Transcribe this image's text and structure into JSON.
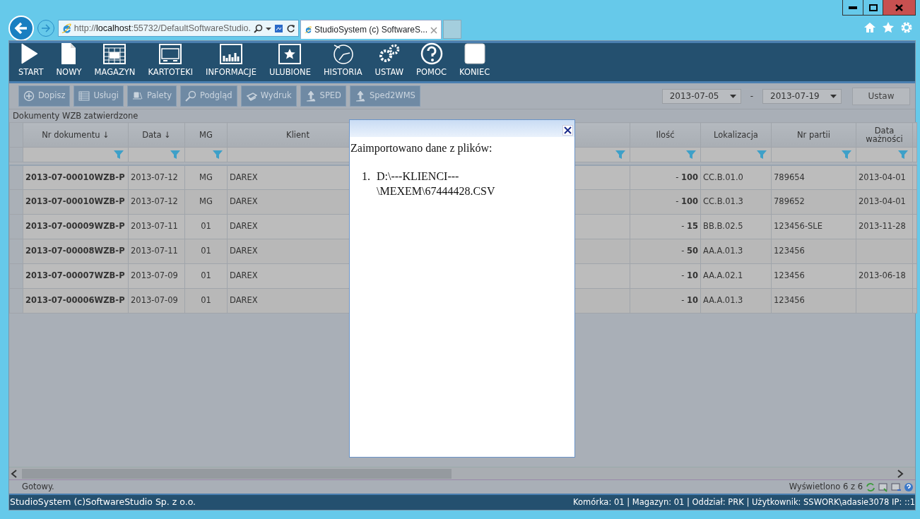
{
  "browser": {
    "address": {
      "scheme": "http://",
      "host": "localhost",
      "rest": ":55732/DefaultSoftwareStudio."
    },
    "tab_title": "StudioSystem (c) SoftwareS..."
  },
  "nav": [
    "START",
    "NOWY",
    "MAGAZYN",
    "KARTOTEKI",
    "INFORMACJE",
    "ULUBIONE",
    "HISTORIA",
    "USTAW",
    "POMOC",
    "KONIEC"
  ],
  "toolbar": [
    "Dopisz",
    "Usługi",
    "Palety",
    "Podgląd",
    "Wydruk",
    "SPED",
    "Sped2WMS"
  ],
  "date_range": {
    "from": "2013-07-05",
    "separator": "-",
    "to": "2013-07-19",
    "apply": "Ustaw"
  },
  "caption": "Dokumenty WZB zatwierdzone",
  "table": {
    "columns": [
      {
        "label": "Nr dokumentu ↓",
        "filter": true
      },
      {
        "label": "Data ↓",
        "filter": true
      },
      {
        "label": "MG",
        "filter": true
      },
      {
        "label": "Klient"
      },
      {
        "filter": true
      },
      {
        "label": "Ilość",
        "filter": true
      },
      {
        "label": "Lokalizacja",
        "filter": true
      },
      {
        "label": "Nr partii",
        "filter": true
      },
      {
        "label": "Data ważności",
        "filter": true
      }
    ],
    "rows": [
      {
        "nr": "2013-07-00010WZB-P",
        "data": "2013-07-12",
        "mg": "MG",
        "klient": "DAREX",
        "ilosc": "- **100**",
        "lokalizacja": "CC.B.01.0",
        "partia": "789654",
        "waznosc": "2013-04-01"
      },
      {
        "nr": "2013-07-00010WZB-P",
        "data": "2013-07-12",
        "mg": "MG",
        "klient": "DAREX",
        "ilosc": "- **100**",
        "lokalizacja": "CC.B.01.3",
        "partia": "789652",
        "waznosc": "2013-04-01"
      },
      {
        "nr": "2013-07-00009WZB-P",
        "data": "2013-07-11",
        "mg": "01",
        "klient": "DAREX",
        "ilosc": "- **15**",
        "lokalizacja": "BB.B.02.5",
        "partia": "123456-SLE",
        "waznosc": "2013-11-28"
      },
      {
        "nr": "2013-07-00008WZB-P",
        "data": "2013-07-11",
        "mg": "01",
        "klient": "DAREX",
        "ilosc": "- **50**",
        "lokalizacja": "AA.A.01.3",
        "partia": "123456"
      },
      {
        "nr": "2013-07-00007WZB-P",
        "data": "2013-07-09",
        "mg": "01",
        "klient": "DAREX",
        "ilosc": "- **10**",
        "lokalizacja": "AA.A.02.1",
        "partia": "123456",
        "waznosc": "2013-06-18"
      },
      {
        "nr": "2013-07-00006WZB-P",
        "data": "2013-07-09",
        "mg": "01",
        "klient": "DAREX",
        "ilosc": "- **10**",
        "lokalizacja": "AA.A.01.3",
        "partia": "123456"
      }
    ]
  },
  "status": {
    "text": "Gotowy.",
    "count": "Wyświetlono 6 z 6"
  },
  "footer": {
    "left": "StudioSystem (c)SoftwareStudio Sp. z o.o.",
    "right": "Komórka: 01 | Magazyn: 01 | Oddział: PRK | Użytkownik: SSWORK\\adasie3078 IP: ::1"
  },
  "dialog": {
    "message": "Zaimportowano dane z plików:",
    "files": [
      {
        "number": "1.",
        "path": "D:\\---KLIENCI---\\MEXEM\\67444428.CSV"
      }
    ]
  }
}
